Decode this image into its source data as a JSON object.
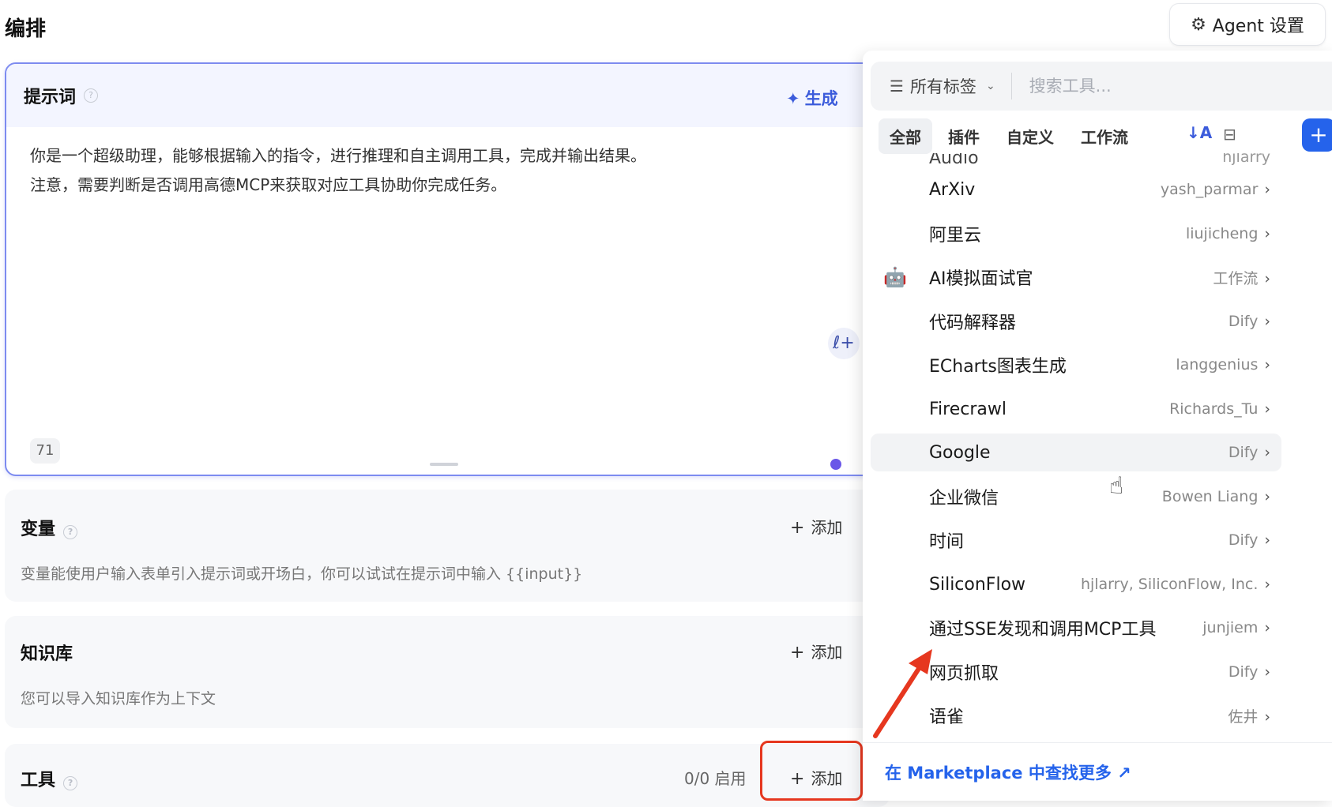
{
  "header": {
    "title": "编排",
    "agent_settings_label": "Agent 设置"
  },
  "prompt": {
    "label": "提示词",
    "generate_label": "生成",
    "line1": "你是一个超级助理，能够根据输入的指令，进行推理和自主调用工具，完成并输出结果。",
    "line2": "注意，需要判断是否调用高德MCP来获取对应工具协助你完成任务。",
    "char_count": "71"
  },
  "variables": {
    "label": "变量",
    "add_label": "添加",
    "desc": "变量能使用户输入表单引入提示词或开场白，你可以试试在提示词中输入 {{input}}"
  },
  "knowledge": {
    "label": "知识库",
    "add_label": "添加",
    "desc": "您可以导入知识库作为上下文"
  },
  "tools": {
    "label": "工具",
    "enabled_count": "0/0 启用",
    "add_label": "添加"
  },
  "picker": {
    "tag_filter_label": "所有标签",
    "search_placeholder": "搜索工具...",
    "tabs": [
      "全部",
      "插件",
      "自定义",
      "工作流"
    ],
    "partial_item": {
      "name": "Audio",
      "author": "hjlarry"
    },
    "items": [
      {
        "name": "ArXiv",
        "author": "yash_parmar",
        "icon": ""
      },
      {
        "name": "阿里云",
        "author": "liujicheng",
        "icon": ""
      },
      {
        "name": "AI模拟面试官",
        "author": "工作流",
        "icon": "🤖"
      },
      {
        "name": "代码解释器",
        "author": "Dify",
        "icon": ""
      },
      {
        "name": "ECharts图表生成",
        "author": "langgenius",
        "icon": ""
      },
      {
        "name": "Firecrawl",
        "author": "Richards_Tu",
        "icon": ""
      },
      {
        "name": "Google",
        "author": "Dify",
        "icon": ""
      },
      {
        "name": "企业微信",
        "author": "Bowen Liang",
        "icon": ""
      },
      {
        "name": "时间",
        "author": "Dify",
        "icon": ""
      },
      {
        "name": "SiliconFlow",
        "author": "hjlarry, SiliconFlow, Inc.",
        "icon": ""
      },
      {
        "name": "通过SSE发现和调用MCP工具",
        "author": "junjiem",
        "icon": ""
      },
      {
        "name": "网页抓取",
        "author": "Dify",
        "icon": ""
      },
      {
        "name": "语雀",
        "author": "佐井",
        "icon": ""
      }
    ],
    "footer_link": "在 Marketplace 中查找更多 ↗"
  },
  "colors": {
    "accent": "#2563eb",
    "annotation": "#e6371f"
  }
}
